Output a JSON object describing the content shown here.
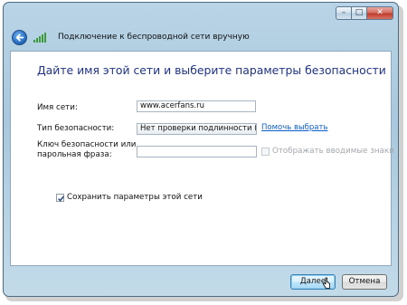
{
  "window": {
    "title": "Подключение к беспроводной сети вручную",
    "controls": {
      "minimize": "–",
      "maximize": "□",
      "close": "✕"
    }
  },
  "content": {
    "heading": "Дайте имя этой сети и выберите параметры безопасности",
    "network_name": {
      "label": "Имя сети:",
      "value": "www.acerfans.ru"
    },
    "security_type": {
      "label": "Тип безопасности:",
      "value": "Нет проверки подлинности (O",
      "link": "Помочь выбрать"
    },
    "security_key": {
      "label_line1": "Ключ безопасности или",
      "label_line2": "парольная фраза:",
      "value": "",
      "show_chars_label": "Отображать вводимые знаки",
      "show_chars_checked": false,
      "show_chars_enabled": false
    },
    "save_params": {
      "label": "Сохранить параметры этой сети",
      "checked": true
    }
  },
  "footer": {
    "next_label": "Далее",
    "cancel_label": "Отмена"
  },
  "icons": {
    "back": "back-arrow-icon",
    "network": "wireless-signal-icon",
    "check": "checkmark-icon",
    "cursor": "mouse-pointer-icon"
  },
  "colors": {
    "heading": "#1e3287",
    "link": "#0b5ec7",
    "frame": "#b9d4e6",
    "close_button": "#c84a3b"
  }
}
